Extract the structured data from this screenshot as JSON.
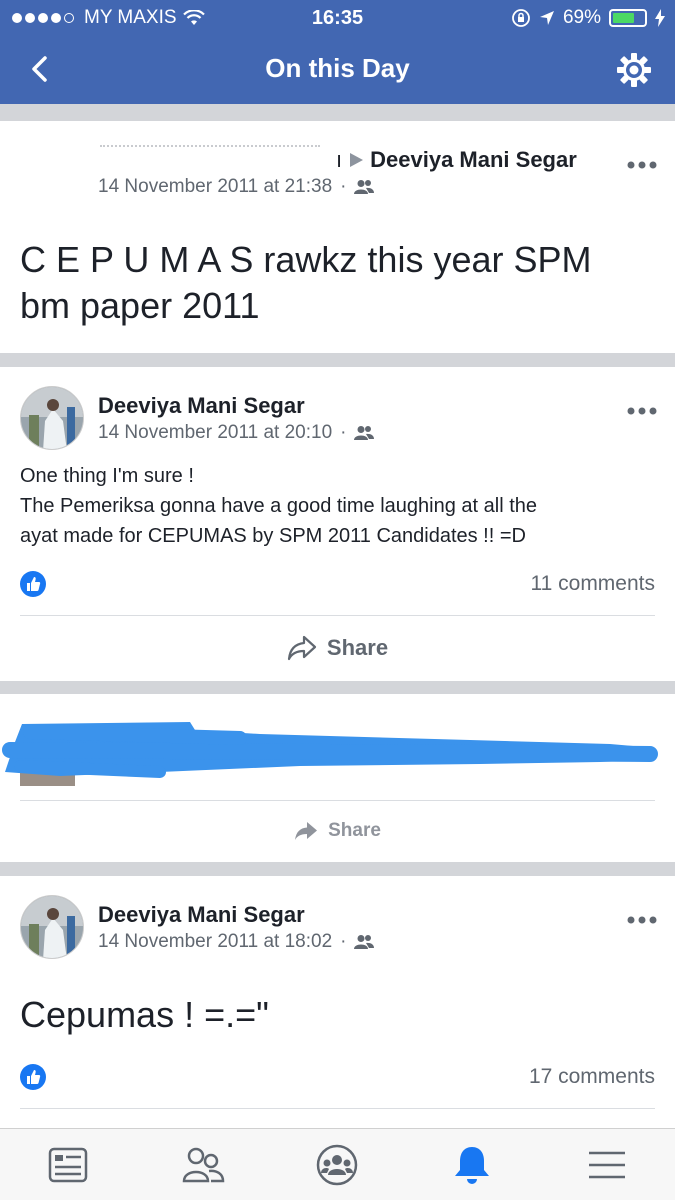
{
  "status_bar": {
    "carrier": "MY MAXIS",
    "time": "16:35",
    "battery": "69%",
    "battery_level": 0.69
  },
  "nav": {
    "title": "On this Day",
    "back_icon": "chevron-left-icon",
    "settings_icon": "gear-icon"
  },
  "posts": [
    {
      "author_tail": "ı",
      "author": "Deeviya Mani Segar",
      "date": "14 November 2011 at 21:38",
      "text": "C E P U M A S rawkz this year SPM bm paper 2011"
    },
    {
      "author": "Deeviya Mani Segar",
      "date": "14 November 2011 at 20:10",
      "text_lines": [
        "One thing I'm sure !",
        "The Pemeriksa gonna have a good time laughing at all the",
        "ayat made for CEPUMAS by SPM 2011 Candidates !! =D"
      ],
      "comments": "11 comments",
      "share_label": "Share"
    },
    {
      "share_label": "Share"
    },
    {
      "author": "Deeviya Mani Segar",
      "date": "14 November 2011 at 18:02",
      "text": "Cepumas ! =.=\"",
      "comments": "17 comments"
    }
  ],
  "colors": {
    "brand": "#4267b2",
    "like": "#1877f2",
    "redaction": "#3b93ec"
  },
  "tab_bar": [
    "news-feed-icon",
    "friends-icon",
    "groups-icon",
    "notifications-icon",
    "menu-icon"
  ]
}
